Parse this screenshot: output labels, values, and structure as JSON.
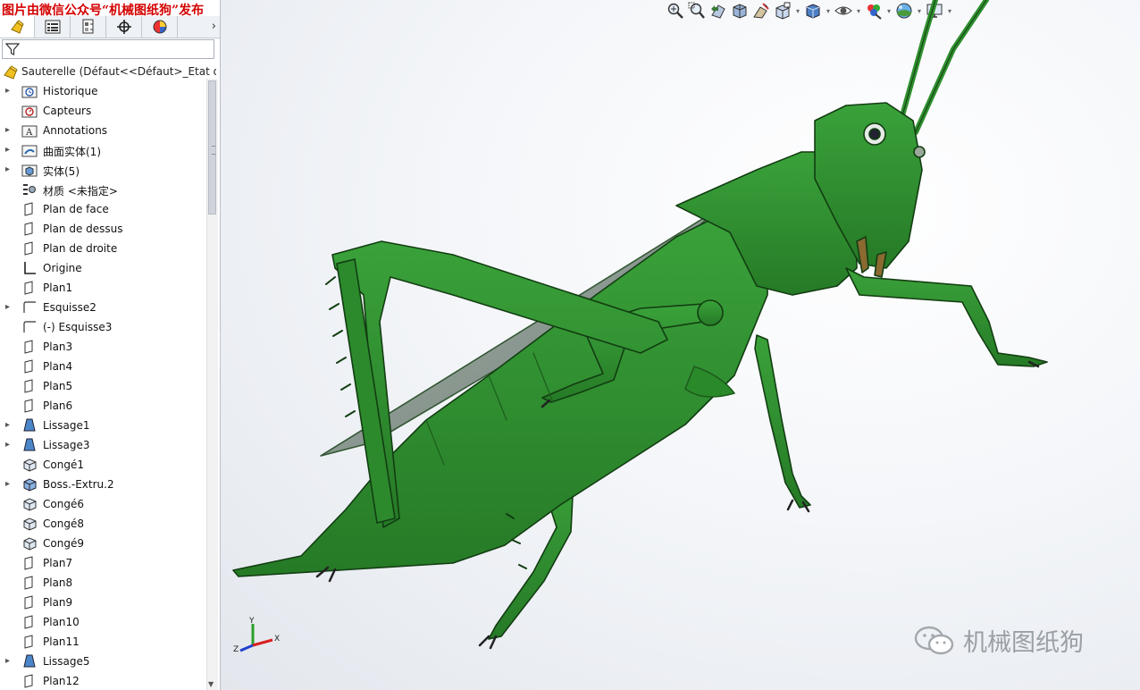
{
  "watermark_top": "图片由微信公众号“机械图纸狗”发布",
  "tabs": [
    {
      "icon": "featuremanager-icon"
    },
    {
      "icon": "propertymanager-icon"
    },
    {
      "icon": "configurationmanager-icon"
    },
    {
      "icon": "dimxpert-icon"
    },
    {
      "icon": "display-manager-icon"
    }
  ],
  "root": {
    "label": "Sauterelle  (Défaut<<Défaut>_Etat d"
  },
  "tree": [
    {
      "label": "Historique",
      "icon": "history-folder-icon",
      "expandable": true
    },
    {
      "label": "Capteurs",
      "icon": "sensors-icon",
      "expandable": false
    },
    {
      "label": "Annotations",
      "icon": "annotations-icon",
      "expandable": true
    },
    {
      "label": "曲面实体(1)",
      "icon": "surface-bodies-icon",
      "expandable": true
    },
    {
      "label": "实体(5)",
      "icon": "solid-bodies-icon",
      "expandable": true
    },
    {
      "label": "材质 <未指定>",
      "icon": "material-icon",
      "expandable": false
    },
    {
      "label": "Plan de face",
      "icon": "plane-icon",
      "expandable": false
    },
    {
      "label": "Plan de dessus",
      "icon": "plane-icon",
      "expandable": false
    },
    {
      "label": "Plan de droite",
      "icon": "plane-icon",
      "expandable": false
    },
    {
      "label": "Origine",
      "icon": "origin-icon",
      "expandable": false
    },
    {
      "label": "Plan1",
      "icon": "plane-icon",
      "expandable": false
    },
    {
      "label": "Esquisse2",
      "icon": "sketch-icon",
      "expandable": true
    },
    {
      "label": "(-) Esquisse3",
      "icon": "sketch-icon",
      "expandable": false
    },
    {
      "label": "Plan3",
      "icon": "plane-icon",
      "expandable": false
    },
    {
      "label": "Plan4",
      "icon": "plane-icon",
      "expandable": false
    },
    {
      "label": "Plan5",
      "icon": "plane-icon",
      "expandable": false
    },
    {
      "label": "Plan6",
      "icon": "plane-icon",
      "expandable": false
    },
    {
      "label": "Lissage1",
      "icon": "loft-icon",
      "expandable": true
    },
    {
      "label": "Lissage3",
      "icon": "loft-icon",
      "expandable": true
    },
    {
      "label": "Congé1",
      "icon": "fillet-icon",
      "expandable": false
    },
    {
      "label": "Boss.-Extru.2",
      "icon": "extrude-icon",
      "expandable": true
    },
    {
      "label": "Congé6",
      "icon": "fillet-icon",
      "expandable": false
    },
    {
      "label": "Congé8",
      "icon": "fillet-icon",
      "expandable": false
    },
    {
      "label": "Congé9",
      "icon": "fillet-icon",
      "expandable": false
    },
    {
      "label": "Plan7",
      "icon": "plane-icon",
      "expandable": false
    },
    {
      "label": "Plan8",
      "icon": "plane-icon",
      "expandable": false
    },
    {
      "label": "Plan9",
      "icon": "plane-icon",
      "expandable": false
    },
    {
      "label": "Plan10",
      "icon": "plane-icon",
      "expandable": false
    },
    {
      "label": "Plan11",
      "icon": "plane-icon",
      "expandable": false
    },
    {
      "label": "Lissage5",
      "icon": "loft-icon",
      "expandable": true
    },
    {
      "label": "Plan12",
      "icon": "plane-icon",
      "expandable": false
    }
  ],
  "heads_up_toolbar": [
    "zoom-to-fit-icon",
    "zoom-to-area-icon",
    "previous-view-icon",
    "section-view-icon",
    "dynamic-annotation-icon",
    "view-orientation-icon",
    "display-style-icon",
    "hide-show-items-icon",
    "edit-appearance-icon",
    "apply-scene-icon",
    "view-settings-icon"
  ],
  "triad": {
    "x": "X",
    "y": "Y",
    "z": "Z"
  },
  "wechat_watermark": "机械图纸狗",
  "colors": {
    "model_green": "#2f8f2f",
    "model_dark": "#1e5e1e",
    "wing": "#8a9a8e",
    "watermark_red": "#d40000"
  }
}
